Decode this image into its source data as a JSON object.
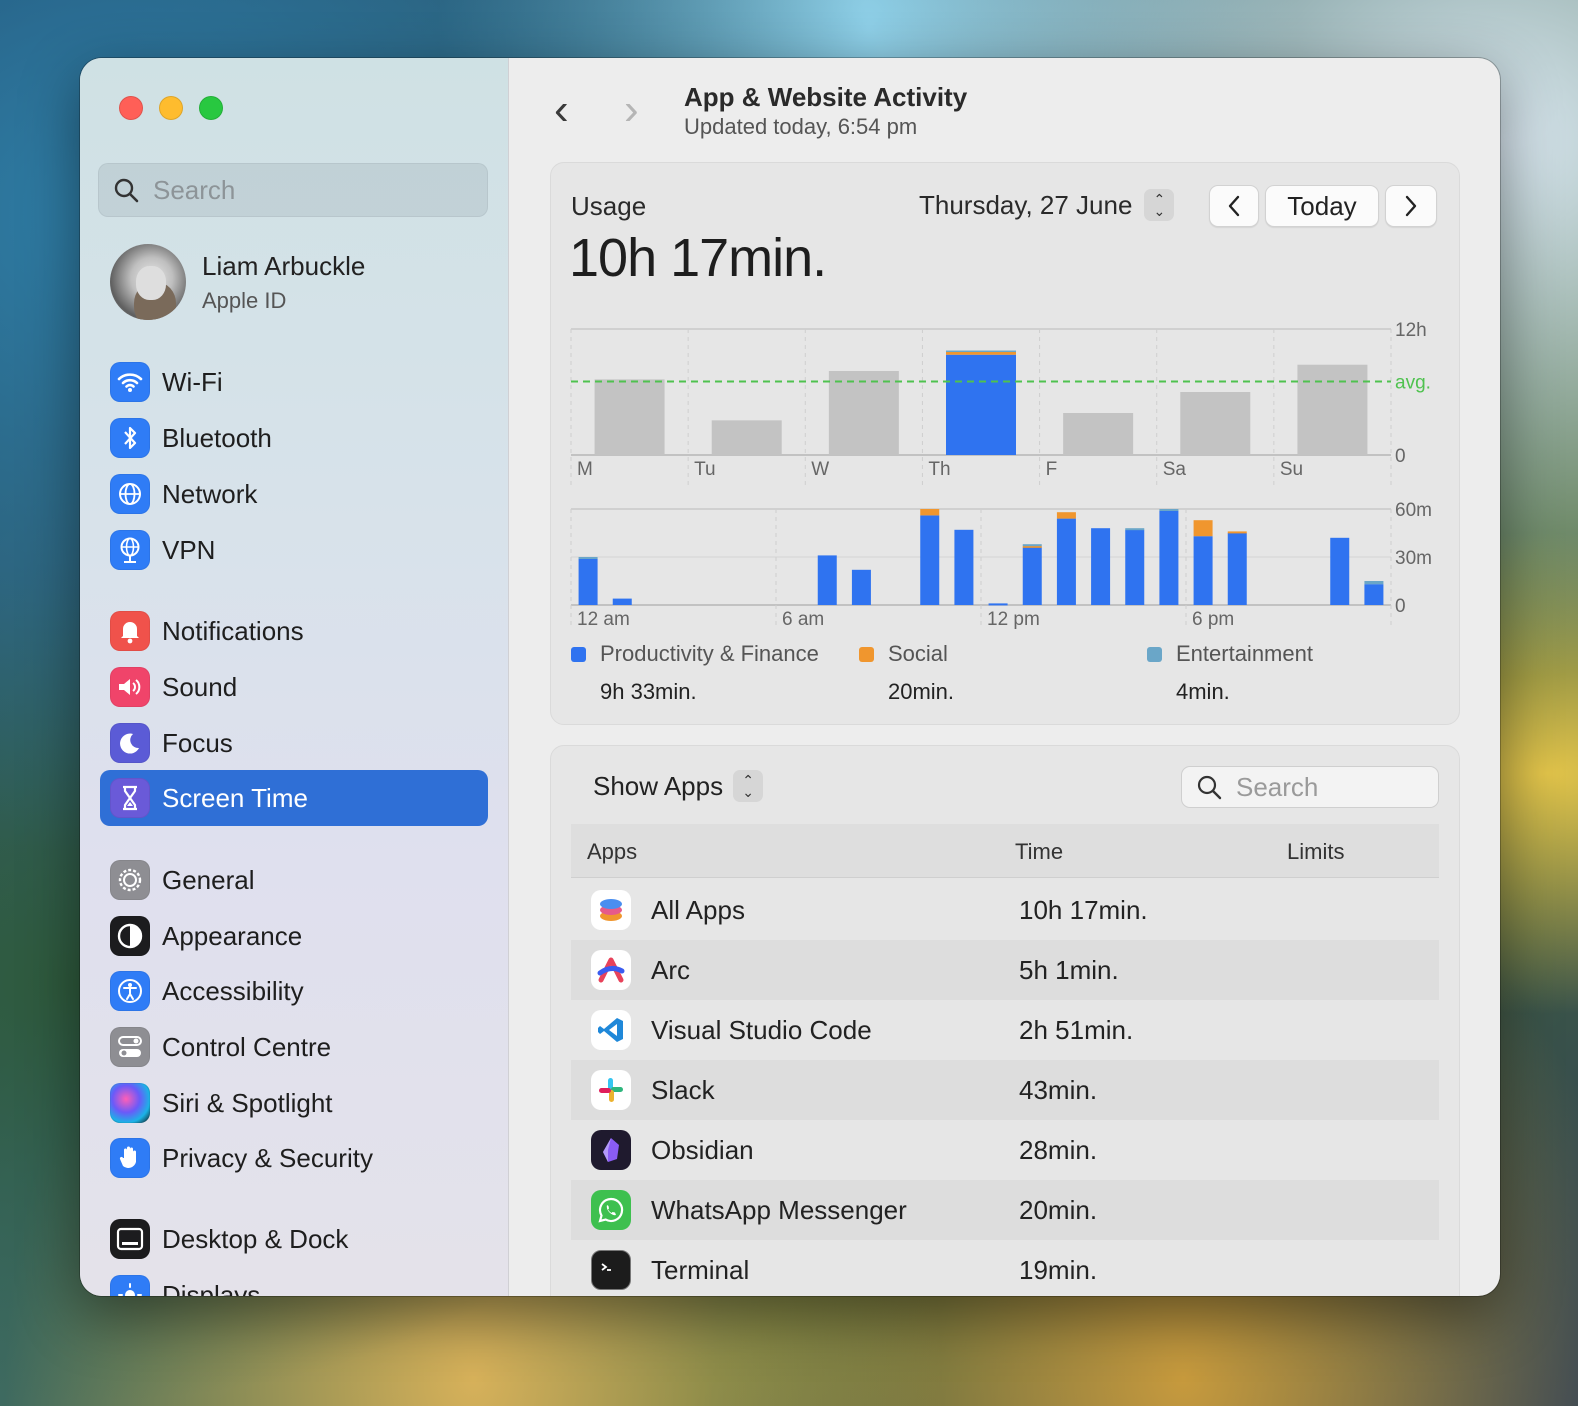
{
  "sidebar": {
    "search_placeholder": "Search",
    "profile": {
      "name": "Liam Arbuckle",
      "subtitle": "Apple ID"
    },
    "items": [
      {
        "label": "Wi-Fi",
        "icon": "wifi-icon",
        "color": "#2f7cf6"
      },
      {
        "label": "Bluetooth",
        "icon": "bluetooth-icon",
        "color": "#2f7cf6"
      },
      {
        "label": "Network",
        "icon": "globe-icon",
        "color": "#2f7cf6"
      },
      {
        "label": "VPN",
        "icon": "vpn-globe-icon",
        "color": "#2f7cf6"
      },
      {
        "label": "Notifications",
        "icon": "bell-icon",
        "color": "#f0524b"
      },
      {
        "label": "Sound",
        "icon": "speaker-icon",
        "color": "#f0446a"
      },
      {
        "label": "Focus",
        "icon": "moon-icon",
        "color": "#5b5bd6"
      },
      {
        "label": "Screen Time",
        "icon": "hourglass-icon",
        "color": "#6a5ad8",
        "active": true
      },
      {
        "label": "General",
        "icon": "gear-icon",
        "color": "#8e8e93"
      },
      {
        "label": "Appearance",
        "icon": "appearance-icon",
        "color": "#1c1c1e"
      },
      {
        "label": "Accessibility",
        "icon": "accessibility-icon",
        "color": "#2f7cf6"
      },
      {
        "label": "Control Centre",
        "icon": "toggles-icon",
        "color": "#8e8e93"
      },
      {
        "label": "Siri & Spotlight",
        "icon": "siri-icon",
        "color": "#3a3a8c"
      },
      {
        "label": "Privacy & Security",
        "icon": "hand-icon",
        "color": "#2f7cf6"
      },
      {
        "label": "Desktop & Dock",
        "icon": "dock-icon",
        "color": "#1c1c1e"
      },
      {
        "label": "Displays",
        "icon": "sun-icon",
        "color": "#2f7cf6"
      }
    ]
  },
  "header": {
    "back_icon": "chevron-left-icon",
    "forward_icon": "chevron-right-icon",
    "title": "App & Website Activity",
    "subtitle": "Updated today, 6:54 pm"
  },
  "usage": {
    "label": "Usage",
    "total": "10h 17min.",
    "date": "Thursday, 27 June",
    "today_button": "Today",
    "prev_icon": "chevron-left-icon",
    "next_icon": "chevron-right-icon"
  },
  "chart_data": [
    {
      "type": "bar",
      "categories": [
        "M",
        "Tu",
        "W",
        "Th",
        "F",
        "Sa",
        "Su"
      ],
      "y_tick_labels": [
        "12h",
        "avg.",
        "0"
      ],
      "ylim": [
        0,
        12
      ],
      "avg_hours": 7.0,
      "series": [
        {
          "name": "Productivity & Finance",
          "values": [
            0,
            0,
            0,
            9.55,
            0,
            0,
            0
          ]
        },
        {
          "name": "Social",
          "values": [
            0,
            0,
            0,
            0.33,
            0,
            0,
            0
          ]
        },
        {
          "name": "Entertainment",
          "values": [
            0,
            0,
            0,
            0.07,
            0,
            0,
            0
          ]
        }
      ],
      "other_days_total_hours": [
        7.2,
        3.3,
        8.0,
        0,
        4.0,
        6.0,
        8.6
      ],
      "highlight_index": 3,
      "colors": {
        "Productivity & Finance": "#2f73f0",
        "Social": "#f0962e",
        "Entertainment": "#6aa6c8",
        "other_day": "#c3c3c3",
        "avg_line": "#4fc24f"
      }
    },
    {
      "type": "bar",
      "x_tick_labels": [
        "12 am",
        "6 am",
        "12 pm",
        "6 pm"
      ],
      "y_tick_labels": [
        "60m",
        "30m",
        "0"
      ],
      "ylim": [
        0,
        60
      ],
      "hours": [
        0,
        1,
        2,
        3,
        4,
        5,
        6,
        7,
        8,
        9,
        10,
        11,
        12,
        13,
        14,
        15,
        16,
        17,
        18,
        19,
        20,
        21,
        22,
        23
      ],
      "series": [
        {
          "name": "Productivity & Finance",
          "values": [
            29,
            4,
            0,
            0,
            0,
            0,
            0,
            31,
            22,
            0,
            56,
            47,
            1,
            36,
            54,
            48,
            47,
            59,
            43,
            45,
            0,
            0,
            42,
            13
          ]
        },
        {
          "name": "Social",
          "values": [
            0,
            0,
            0,
            0,
            0,
            0,
            0,
            0,
            0,
            0,
            4,
            0,
            0,
            1,
            4,
            0,
            0,
            0,
            10,
            1,
            0,
            0,
            0,
            0
          ]
        },
        {
          "name": "Entertainment",
          "values": [
            1,
            0,
            0,
            0,
            0,
            0,
            0,
            0,
            0,
            0,
            0,
            0,
            0,
            1,
            0,
            0,
            1,
            1,
            0,
            0,
            0,
            0,
            0,
            2
          ]
        }
      ],
      "colors": {
        "Productivity & Finance": "#2f73f0",
        "Social": "#f0962e",
        "Entertainment": "#6aa6c8"
      }
    }
  ],
  "legend": [
    {
      "label": "Productivity & Finance",
      "value": "9h 33min.",
      "color": "#2f73f0"
    },
    {
      "label": "Social",
      "value": "20min.",
      "color": "#f0962e"
    },
    {
      "label": "Entertainment",
      "value": "4min.",
      "color": "#6aa6c8"
    }
  ],
  "apps_panel": {
    "show_selector": "Show Apps",
    "search_placeholder": "Search",
    "columns": {
      "apps": "Apps",
      "time": "Time",
      "limits": "Limits"
    },
    "rows": [
      {
        "name": "All Apps",
        "time": "10h 17min.",
        "icon": "stack-icon"
      },
      {
        "name": "Arc",
        "time": "5h 1min.",
        "icon": "arc-icon"
      },
      {
        "name": "Visual Studio Code",
        "time": "2h 51min.",
        "icon": "vscode-icon"
      },
      {
        "name": "Slack",
        "time": "43min.",
        "icon": "slack-icon"
      },
      {
        "name": "Obsidian",
        "time": "28min.",
        "icon": "obsidian-icon"
      },
      {
        "name": "WhatsApp Messenger",
        "time": "20min.",
        "icon": "whatsapp-icon"
      },
      {
        "name": "Terminal",
        "time": "19min.",
        "icon": "terminal-icon"
      }
    ]
  }
}
